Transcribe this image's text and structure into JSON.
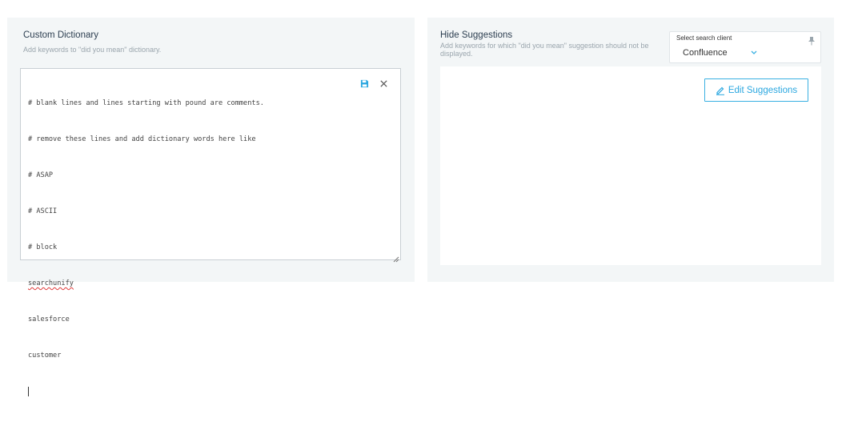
{
  "custom_dictionary": {
    "title": "Custom Dictionary",
    "description": "Add keywords to \"did you mean\" dictionary.",
    "lines": [
      "# blank lines and lines starting with pound are comments.",
      "# remove these lines and add dictionary words here like",
      "# ASAP",
      "# ASCII",
      "# block",
      "searchunify",
      "salesforce",
      "customer"
    ],
    "save_icon": "save-icon",
    "close_icon": "close-icon"
  },
  "hide_suggestions": {
    "title": "Hide Suggestions",
    "description": "Add keywords for which \"did you mean\" suggestion should not be displayed.",
    "client_label": "Select search client",
    "client_value": "Confluence",
    "edit_button_label": "Edit Suggestions",
    "pin_icon": "pin-icon",
    "edit_icon": "pencil-icon"
  },
  "colors": {
    "panel_bg": "#f3f6f7",
    "accent": "#2aa7e0",
    "spell_error": "#e03a3a"
  }
}
